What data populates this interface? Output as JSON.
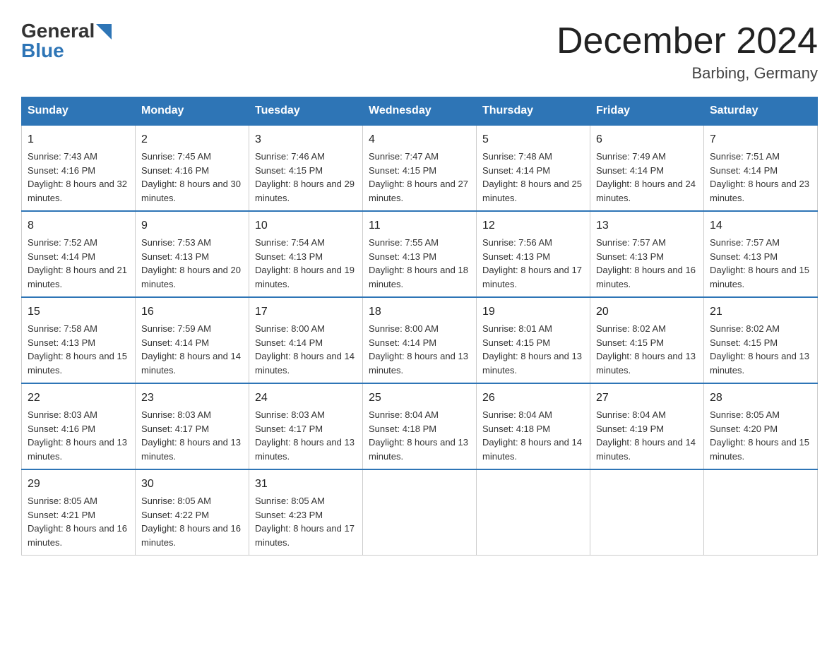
{
  "header": {
    "logo_general": "General",
    "logo_blue": "Blue",
    "month_title": "December 2024",
    "location": "Barbing, Germany"
  },
  "days_of_week": [
    "Sunday",
    "Monday",
    "Tuesday",
    "Wednesday",
    "Thursday",
    "Friday",
    "Saturday"
  ],
  "weeks": [
    [
      {
        "day": "1",
        "sunrise": "7:43 AM",
        "sunset": "4:16 PM",
        "daylight": "8 hours and 32 minutes."
      },
      {
        "day": "2",
        "sunrise": "7:45 AM",
        "sunset": "4:16 PM",
        "daylight": "8 hours and 30 minutes."
      },
      {
        "day": "3",
        "sunrise": "7:46 AM",
        "sunset": "4:15 PM",
        "daylight": "8 hours and 29 minutes."
      },
      {
        "day": "4",
        "sunrise": "7:47 AM",
        "sunset": "4:15 PM",
        "daylight": "8 hours and 27 minutes."
      },
      {
        "day": "5",
        "sunrise": "7:48 AM",
        "sunset": "4:14 PM",
        "daylight": "8 hours and 25 minutes."
      },
      {
        "day": "6",
        "sunrise": "7:49 AM",
        "sunset": "4:14 PM",
        "daylight": "8 hours and 24 minutes."
      },
      {
        "day": "7",
        "sunrise": "7:51 AM",
        "sunset": "4:14 PM",
        "daylight": "8 hours and 23 minutes."
      }
    ],
    [
      {
        "day": "8",
        "sunrise": "7:52 AM",
        "sunset": "4:14 PM",
        "daylight": "8 hours and 21 minutes."
      },
      {
        "day": "9",
        "sunrise": "7:53 AM",
        "sunset": "4:13 PM",
        "daylight": "8 hours and 20 minutes."
      },
      {
        "day": "10",
        "sunrise": "7:54 AM",
        "sunset": "4:13 PM",
        "daylight": "8 hours and 19 minutes."
      },
      {
        "day": "11",
        "sunrise": "7:55 AM",
        "sunset": "4:13 PM",
        "daylight": "8 hours and 18 minutes."
      },
      {
        "day": "12",
        "sunrise": "7:56 AM",
        "sunset": "4:13 PM",
        "daylight": "8 hours and 17 minutes."
      },
      {
        "day": "13",
        "sunrise": "7:57 AM",
        "sunset": "4:13 PM",
        "daylight": "8 hours and 16 minutes."
      },
      {
        "day": "14",
        "sunrise": "7:57 AM",
        "sunset": "4:13 PM",
        "daylight": "8 hours and 15 minutes."
      }
    ],
    [
      {
        "day": "15",
        "sunrise": "7:58 AM",
        "sunset": "4:13 PM",
        "daylight": "8 hours and 15 minutes."
      },
      {
        "day": "16",
        "sunrise": "7:59 AM",
        "sunset": "4:14 PM",
        "daylight": "8 hours and 14 minutes."
      },
      {
        "day": "17",
        "sunrise": "8:00 AM",
        "sunset": "4:14 PM",
        "daylight": "8 hours and 14 minutes."
      },
      {
        "day": "18",
        "sunrise": "8:00 AM",
        "sunset": "4:14 PM",
        "daylight": "8 hours and 13 minutes."
      },
      {
        "day": "19",
        "sunrise": "8:01 AM",
        "sunset": "4:15 PM",
        "daylight": "8 hours and 13 minutes."
      },
      {
        "day": "20",
        "sunrise": "8:02 AM",
        "sunset": "4:15 PM",
        "daylight": "8 hours and 13 minutes."
      },
      {
        "day": "21",
        "sunrise": "8:02 AM",
        "sunset": "4:15 PM",
        "daylight": "8 hours and 13 minutes."
      }
    ],
    [
      {
        "day": "22",
        "sunrise": "8:03 AM",
        "sunset": "4:16 PM",
        "daylight": "8 hours and 13 minutes."
      },
      {
        "day": "23",
        "sunrise": "8:03 AM",
        "sunset": "4:17 PM",
        "daylight": "8 hours and 13 minutes."
      },
      {
        "day": "24",
        "sunrise": "8:03 AM",
        "sunset": "4:17 PM",
        "daylight": "8 hours and 13 minutes."
      },
      {
        "day": "25",
        "sunrise": "8:04 AM",
        "sunset": "4:18 PM",
        "daylight": "8 hours and 13 minutes."
      },
      {
        "day": "26",
        "sunrise": "8:04 AM",
        "sunset": "4:18 PM",
        "daylight": "8 hours and 14 minutes."
      },
      {
        "day": "27",
        "sunrise": "8:04 AM",
        "sunset": "4:19 PM",
        "daylight": "8 hours and 14 minutes."
      },
      {
        "day": "28",
        "sunrise": "8:05 AM",
        "sunset": "4:20 PM",
        "daylight": "8 hours and 15 minutes."
      }
    ],
    [
      {
        "day": "29",
        "sunrise": "8:05 AM",
        "sunset": "4:21 PM",
        "daylight": "8 hours and 16 minutes."
      },
      {
        "day": "30",
        "sunrise": "8:05 AM",
        "sunset": "4:22 PM",
        "daylight": "8 hours and 16 minutes."
      },
      {
        "day": "31",
        "sunrise": "8:05 AM",
        "sunset": "4:23 PM",
        "daylight": "8 hours and 17 minutes."
      },
      null,
      null,
      null,
      null
    ]
  ]
}
